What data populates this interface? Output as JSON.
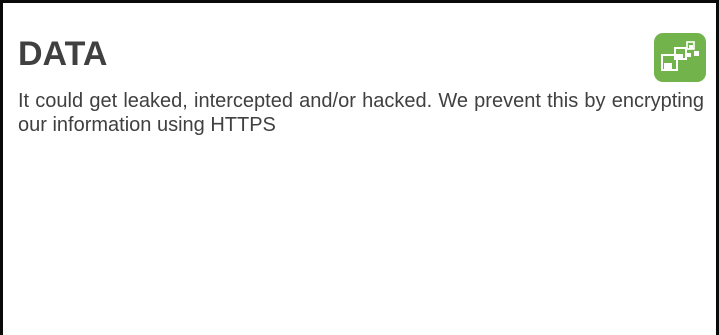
{
  "card": {
    "title": "DATA",
    "description": "It could get leaked, intercepted and/or hacked. We prevent this by encrypting our information using HTTPS"
  },
  "badge": {
    "icon": "cubes-icon",
    "color": "#73b34b"
  }
}
